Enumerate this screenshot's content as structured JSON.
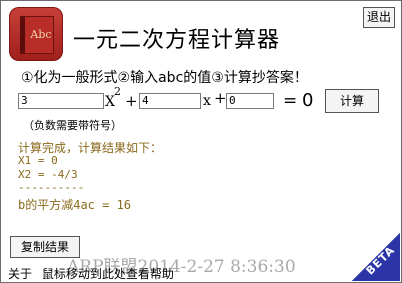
{
  "app": {
    "title": "一元二次方程计算器",
    "icon_name": "book-icon",
    "icon_label": "Abc",
    "exit_label": "退出"
  },
  "instructions": {
    "steps": "①化为一般形式②输入abc的值③计算抄答案！"
  },
  "equation": {
    "a_value": "3",
    "b_value": "4",
    "c_value": "0",
    "x_label": "X",
    "superscript": "2",
    "plus_1": "+",
    "x_label_2": "x",
    "plus_2": "+",
    "equals": "=",
    "zero": "0",
    "calc_label": "计算"
  },
  "hint": "（负数需要带符号）",
  "result": {
    "title": "计算完成，计算结果如下：",
    "x1": "X1 = 0",
    "x2": "X2 = -4/3",
    "separator": "----------",
    "discriminant": "b的平方减4ac = 16"
  },
  "copy_label": "复制结果",
  "watermark": "ARP联盟2014-2-27 8:36:30",
  "footer": {
    "about": "关于",
    "help": "鼠标移动到此处查看帮助"
  },
  "beta": "BETA",
  "colors": {
    "result_text": "#8a6a1c",
    "beta_corner": "#2b35a8",
    "icon_red": "#b92d28"
  }
}
